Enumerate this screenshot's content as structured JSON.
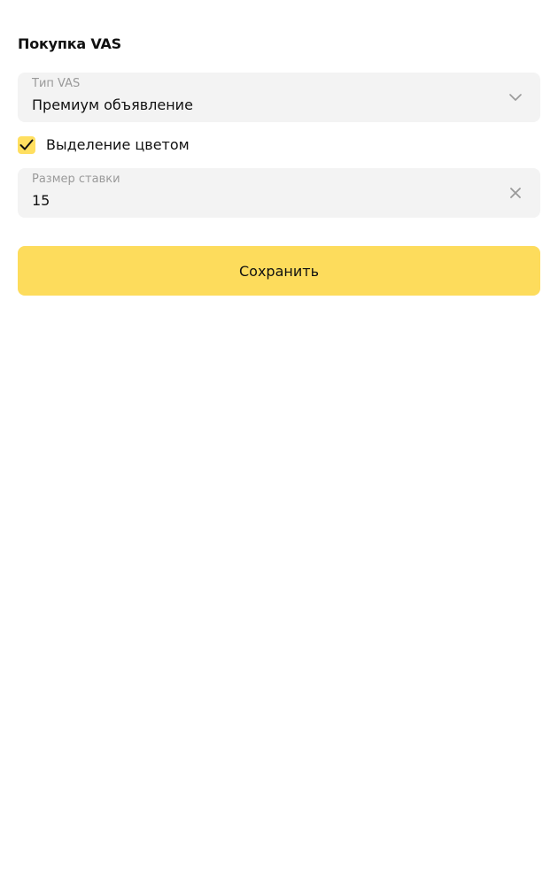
{
  "page": {
    "title": "Покупка VAS"
  },
  "form": {
    "vas_type": {
      "label": "Тип VAS",
      "value": "Премиум объявление",
      "icon": "chevron-down-icon"
    },
    "color_highlight": {
      "label": "Выделение цветом",
      "checked": true,
      "icon": "checkmark-icon"
    },
    "bid": {
      "label": "Размер ставки",
      "value": "15",
      "icon": "clear-icon"
    },
    "save_label": "Сохранить"
  },
  "colors": {
    "accent": "#fddc5c",
    "field_bg": "#f3f3f3",
    "label": "#9a9a9a"
  }
}
